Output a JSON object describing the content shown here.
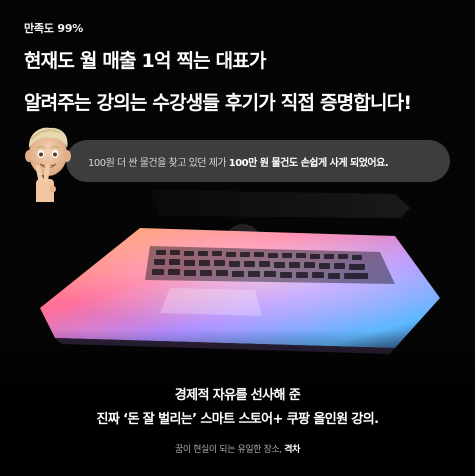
{
  "badge": "만족도 99%",
  "headline": {
    "line1": "현재도 월 매출 1억 찍는 대표가",
    "line2": "알려주는 강의는 수강생들 후기가 직접 증명합니다!"
  },
  "review": {
    "prefix": "100원 더 싼 물건을 찾고 있던 제가 ",
    "highlight": "100만 원 물건도 손쉽게 사게 되었어요."
  },
  "tagline": {
    "line1": "경제적 자유를 선사해 준",
    "line2": "진짜 ‘돈 잘 벌리는’ 스마트 스토어+ 쿠팡 올인원 강의."
  },
  "footer": {
    "prefix": "꿈이 현실이 되는 유일한 장소,",
    "brand": "격차"
  },
  "colors": {
    "background": "#000000",
    "bubble": "#3d3d3d",
    "text": "#ffffff",
    "muted": "#a8a8a8"
  },
  "icons": {
    "avatar": "memoji-peace-sign",
    "laptop": "laptop-backlit"
  }
}
